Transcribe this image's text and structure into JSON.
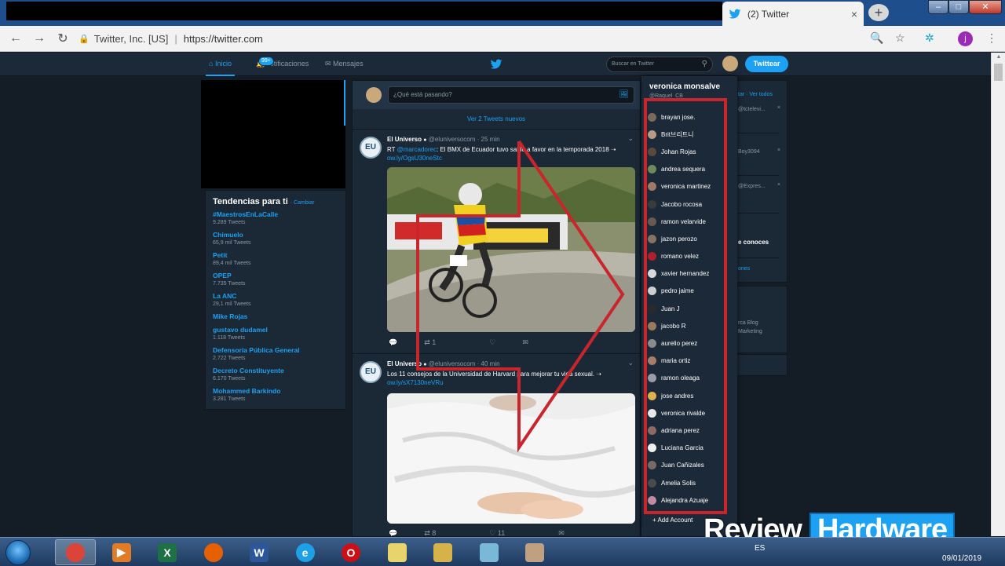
{
  "browser": {
    "tab_title": "(2) Twitter",
    "tab_close": "×",
    "new_tab": "+",
    "site_identity": "Twitter, Inc. [US]",
    "url": "https://twitter.com",
    "profile_initial": "j"
  },
  "twitter_nav": {
    "home": "Inicio",
    "notifications": "Notificaciones",
    "notifications_badge": "99+",
    "messages": "Mensajes",
    "search_placeholder": "Buscar en Twitter",
    "tweet_button": "Twittear"
  },
  "trends": {
    "title": "Tendencias para ti",
    "change": "· Cambiar",
    "items": [
      {
        "name": "#MaestrosEnLaCalle",
        "count": "9.289 Tweets"
      },
      {
        "name": "Chimuelo",
        "count": "65,9 mil Tweets"
      },
      {
        "name": "Petit",
        "count": "89,4 mil Tweets"
      },
      {
        "name": "OPEP",
        "count": "7.735 Tweets"
      },
      {
        "name": "La ANC",
        "count": "29,1 mil Tweets"
      },
      {
        "name": "Mike Rojas",
        "count": ""
      },
      {
        "name": "gustavo dudamel",
        "count": "1.118 Tweets"
      },
      {
        "name": "Defensoría Pública General",
        "count": "2.722 Tweets"
      },
      {
        "name": "Decreto Constituyente",
        "count": "6.170 Tweets"
      },
      {
        "name": "Mohammed Barkindo",
        "count": "3.281 Tweets"
      }
    ]
  },
  "timeline": {
    "compose_placeholder": "¿Qué está pasando?",
    "new_tweets": "Ver 2 Tweets nuevos",
    "tweets": [
      {
        "avatar": "EU",
        "name": "El Universo",
        "handle": "@eluniversocom · 25 min",
        "text_prefix": "RT ",
        "mention": "@marcadorec",
        "text": ": El BMX de Ecuador tuvo saldo a favor en la temporada 2018 ➝",
        "link": "ow.ly/OgsU30neStc",
        "retweets": "1",
        "likes": ""
      },
      {
        "avatar": "EU",
        "name": "El Universo",
        "handle": "@eluniversocom · 40 min",
        "text_prefix": "",
        "mention": "",
        "text": "Los 11 consejos de la Universidad de Harvard para mejorar tu vida sexual. ➝",
        "link": "ow.ly/sX7130neVRu",
        "retweets": "8",
        "likes": "11"
      }
    ]
  },
  "who_to_follow": {
    "header_links": "tar · Ver todos",
    "rows": [
      "@tctelevi...",
      "Boy3094",
      "@Expres..."
    ],
    "know_text": "e conoces",
    "links_text": "ones",
    "footer_a": "rca  Blog",
    "footer_b": "Marketing"
  },
  "account_switcher": {
    "name": "veronica monsalve",
    "handle": "@Raquel_CB",
    "accounts": [
      {
        "name": "brayan jose.",
        "color": "#7a6a5a"
      },
      {
        "name": "Brit브리트니",
        "color": "#b89a86"
      },
      {
        "name": "Johan Rojas",
        "color": "#5a4a3a"
      },
      {
        "name": "andrea sequera",
        "color": "#6e8a5a"
      },
      {
        "name": "veronica martinez",
        "color": "#a07a62"
      },
      {
        "name": "Jacobo rocosa",
        "color": "#3a3a3a"
      },
      {
        "name": "ramon velarvide",
        "color": "#6a5a4e"
      },
      {
        "name": "jazon perozo",
        "color": "#8a7262"
      },
      {
        "name": "romano velez",
        "color": "#b0202a"
      },
      {
        "name": "xavier hernandez",
        "color": "#d8d8d8"
      },
      {
        "name": "pedro jaime",
        "color": "#cfcfcf"
      },
      {
        "name": "Juan J",
        "color": "#2a2a2a"
      },
      {
        "name": "jacobo R",
        "color": "#9a7a5a"
      },
      {
        "name": "aurelio perez",
        "color": "#8a8a8a"
      },
      {
        "name": "maria ortiz",
        "color": "#a67c6a"
      },
      {
        "name": "ramon oleaga",
        "color": "#9a9aa8"
      },
      {
        "name": "jose andres",
        "color": "#e0b050"
      },
      {
        "name": "veronica rivalde",
        "color": "#e8e8e8"
      },
      {
        "name": "adriana perez",
        "color": "#8a6a62"
      },
      {
        "name": "Luciana Garcia",
        "color": "#f0f0f0"
      },
      {
        "name": "Juan Cañizales",
        "color": "#7a6a62"
      },
      {
        "name": "Amelia Solis",
        "color": "#4a4a4a"
      },
      {
        "name": "Alejandra Azuaje",
        "color": "#c08aa0"
      }
    ],
    "add_account": "+ Add Account"
  },
  "watermark": {
    "word1": "Review",
    "word2": "Hardware"
  },
  "taskbar": {
    "lang": "ES",
    "date": "09/01/2019",
    "apps": [
      {
        "name": "chrome",
        "icon": "chrome-icon",
        "color": "#db4437",
        "glyph": "",
        "active": true
      },
      {
        "name": "media",
        "icon": "media-player-icon",
        "color": "#e07b26",
        "glyph": "▶",
        "active": false
      },
      {
        "name": "excel",
        "icon": "excel-icon",
        "color": "#1e7145",
        "glyph": "X",
        "active": false
      },
      {
        "name": "firefox",
        "icon": "firefox-icon",
        "color": "#e66000",
        "glyph": "",
        "active": false
      },
      {
        "name": "word",
        "icon": "word-icon",
        "color": "#2b579a",
        "glyph": "W",
        "active": false
      },
      {
        "name": "ie",
        "icon": "internet-explorer-icon",
        "color": "#1ea0e6",
        "glyph": "e",
        "active": false
      },
      {
        "name": "opera",
        "icon": "opera-icon",
        "color": "#cc0f16",
        "glyph": "O",
        "active": false
      },
      {
        "name": "notes",
        "icon": "sticky-notes-icon",
        "color": "#e8d46a",
        "glyph": "",
        "active": false
      },
      {
        "name": "explorer",
        "icon": "file-explorer-icon",
        "color": "#d6b24a",
        "glyph": "",
        "active": false
      },
      {
        "name": "tablet",
        "icon": "tablet-tool-icon",
        "color": "#7ab8d8",
        "glyph": "",
        "active": false
      },
      {
        "name": "paint",
        "icon": "paint-icon",
        "color": "#c0a080",
        "glyph": "",
        "active": false
      }
    ]
  }
}
